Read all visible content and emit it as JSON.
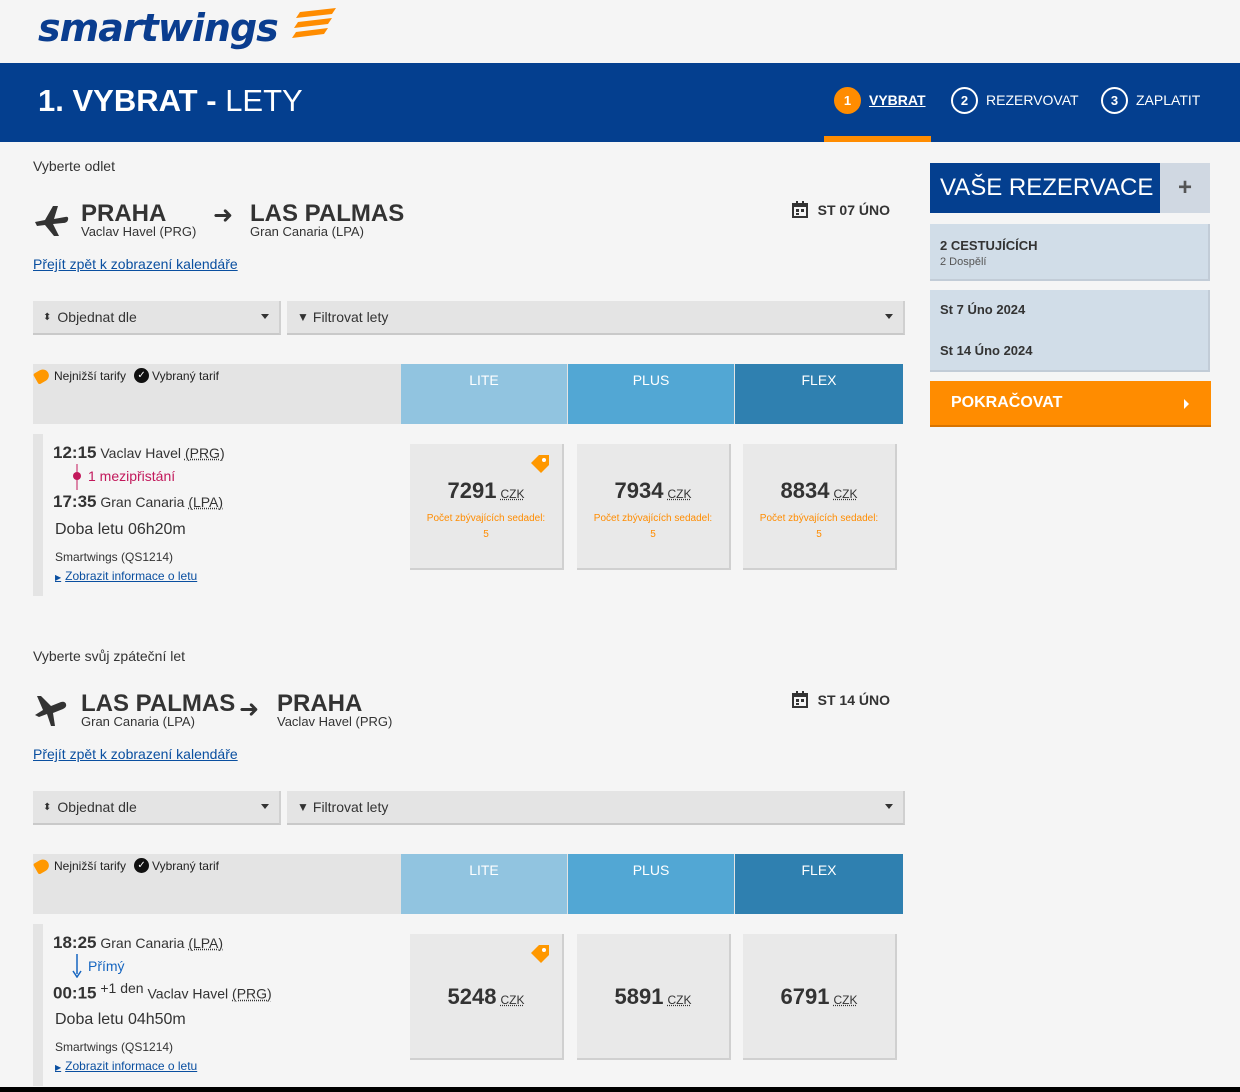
{
  "brand": {
    "name": "smartwings"
  },
  "header": {
    "title_bold": "1. VYBRAT -",
    "title_light": "LETY",
    "steps": [
      {
        "num": "1",
        "label": "VYBRAT",
        "active": true
      },
      {
        "num": "2",
        "label": "REZERVOVAT"
      },
      {
        "num": "3",
        "label": "ZAPLATIT"
      }
    ]
  },
  "outbound": {
    "section_label": "Vyberte odlet",
    "from_city": "PRAHA",
    "from_airport": "Vaclav Havel (PRG)",
    "to_city": "LAS PALMAS",
    "to_airport": "Gran Canaria (LPA)",
    "date": "ST 07 ÚNO",
    "calendar_link": "Přejít zpět k zobrazení kalendáře",
    "order_label": "Objednat dle",
    "filter_label": "Filtrovat lety",
    "flight": {
      "dep_time": "12:15",
      "dep_airport": "Vaclav Havel",
      "dep_code": "(PRG)",
      "stops": "1 mezipřistání",
      "arr_time": "17:35",
      "arr_airport": "Gran Canaria",
      "arr_code": "(LPA)",
      "duration": "Doba letu 06h20m",
      "flight_no": "Smartwings (QS1214)",
      "info_link": "Zobrazit informace o letu",
      "fares": [
        {
          "price": "7291",
          "currency": "CZK",
          "seats_label": "Počet zbývajících sedadel:",
          "seats": "5",
          "lowest": true
        },
        {
          "price": "7934",
          "currency": "CZK",
          "seats_label": "Počet zbývajících sedadel:",
          "seats": "5"
        },
        {
          "price": "8834",
          "currency": "CZK",
          "seats_label": "Počet zbývajících sedadel:",
          "seats": "5"
        }
      ]
    }
  },
  "inbound": {
    "section_label": "Vyberte svůj zpáteční let",
    "from_city": "LAS PALMAS",
    "from_airport": "Gran Canaria (LPA)",
    "to_city": "PRAHA",
    "to_airport": "Vaclav Havel (PRG)",
    "date": "ST 14 ÚNO",
    "calendar_link": "Přejít zpět k zobrazení kalendáře",
    "order_label": "Objednat dle",
    "filter_label": "Filtrovat lety",
    "flight": {
      "dep_time": "18:25",
      "dep_airport": "Gran Canaria",
      "dep_code": "(LPA)",
      "stops": "Přímý",
      "arr_time": "00:15",
      "arr_plus": "+1 den",
      "arr_airport": "Vaclav Havel",
      "arr_code": "(PRG)",
      "duration": "Doba letu 04h50m",
      "flight_no": "Smartwings (QS1214)",
      "info_link": "Zobrazit informace o letu",
      "fares": [
        {
          "price": "5248",
          "currency": "CZK",
          "lowest": true
        },
        {
          "price": "5891",
          "currency": "CZK"
        },
        {
          "price": "6791",
          "currency": "CZK"
        }
      ]
    }
  },
  "legend": {
    "lowest": "Nejnižší tarify",
    "selected": "Vybraný tarif"
  },
  "fare_columns": [
    {
      "label": "LITE",
      "color": "#91c4e0"
    },
    {
      "label": "PLUS",
      "color": "#52a7d4"
    },
    {
      "label": "FLEX",
      "color": "#2f80b0"
    }
  ],
  "sidebar": {
    "title": "VAŠE REZERVACE",
    "add": "+",
    "passengers": "2 CESTUJÍCÍCH",
    "passengers_detail": "2 Dospělí",
    "date_out": "St 7 Úno 2024",
    "date_back": "St 14 Úno 2024",
    "continue": "POKRAČOVAT"
  },
  "colors": {
    "brand_blue": "#043f8f",
    "accent_orange": "#ff8c00",
    "stops_red": "#c2185b",
    "direct_blue": "#1565c0"
  }
}
